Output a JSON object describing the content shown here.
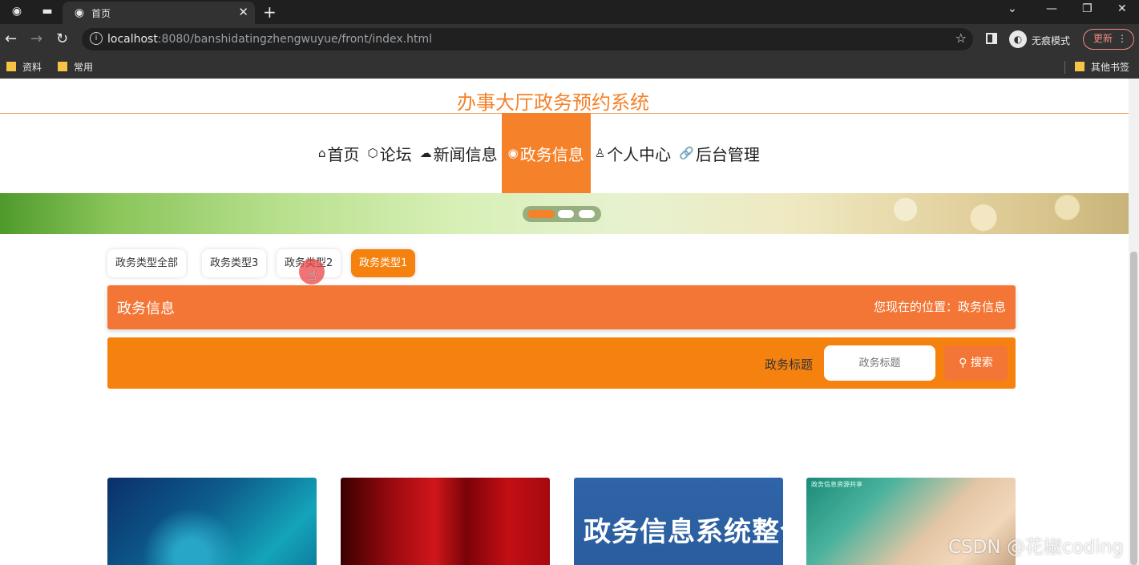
{
  "browser": {
    "tab_title": "首页",
    "tab_close": "✕",
    "new_tab": "+",
    "url_host": "localhost",
    "url_rest": ":8080/banshidatingzhengwuyue/front/index.html",
    "incognito_label": "无痕模式",
    "update_label": "更新",
    "bookmarks": [
      "资料",
      "常用"
    ],
    "other_bookmarks": "其他书签"
  },
  "site": {
    "title": "办事大厅政务预约系统"
  },
  "nav": {
    "items": [
      {
        "icon": "⌂",
        "label": "首页"
      },
      {
        "icon": "⬡",
        "label": "论坛"
      },
      {
        "icon": "☁",
        "label": "新闻信息"
      },
      {
        "icon": "◉",
        "label": "政务信息"
      },
      {
        "icon": "♙",
        "label": "个人中心"
      },
      {
        "icon": "🔗",
        "label": "后台管理"
      }
    ],
    "active_index": 3
  },
  "banner": {
    "slides": 3,
    "active_slide": 0
  },
  "categories": {
    "items": [
      "政务类型全部",
      "政务类型3",
      "政务类型2",
      "政务类型1"
    ],
    "active_index": 3
  },
  "section": {
    "name": "政务信息",
    "breadcrumb": "您现在的位置：政务信息"
  },
  "search": {
    "label": "政务标题",
    "placeholder": "政务标题",
    "button_label": "搜索"
  },
  "cards": {
    "card3_text": "政务信息系统整合共享",
    "card4_caption": "政务信息资源共享"
  },
  "watermark": "CSDN @花椒coding",
  "colors": {
    "accent": "#f5822a",
    "section_head": "#f47636",
    "search_bar": "#f5820f"
  }
}
